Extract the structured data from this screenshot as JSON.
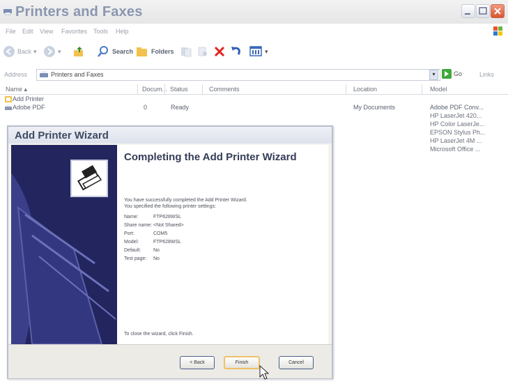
{
  "window": {
    "title": "Printers and Faxes"
  },
  "menu": [
    "File",
    "Edit",
    "View",
    "Favorites",
    "Tools",
    "Help"
  ],
  "toolbar": {
    "back": "Back",
    "search": "Search",
    "folders": "Folders"
  },
  "address": {
    "label": "Address",
    "value": "Printers and Faxes",
    "go": "Go",
    "links": "Links"
  },
  "columns": {
    "name": "Name",
    "documents": "Docum...",
    "status": "Status",
    "comments": "Comments",
    "location": "Location",
    "model": "Model"
  },
  "rows": [
    {
      "name": "Add Printer"
    },
    {
      "name": "Adobe PDF",
      "documents": "0",
      "status": "Ready",
      "location": "My Documents",
      "model": "Adobe PDF Conv..."
    }
  ],
  "other_models": [
    "HP LaserJet 420...",
    "HP Color LaserJe...",
    "EPSON Stylus Ph...",
    "HP LaserJet 4M ...",
    "Microsoft Office ..."
  ],
  "wizard": {
    "title": "Add Printer Wizard",
    "heading": "Completing the Add Printer Wizard",
    "line1": "You have successfully completed the Add Printer Wizard.",
    "line2": "You specified the following printer settings:",
    "settings": [
      {
        "key": "Name:",
        "value": "FTP628WSL"
      },
      {
        "key": "Share name:",
        "value": "<Not Shared>"
      },
      {
        "key": "Port:",
        "value": "COM5"
      },
      {
        "key": "Model:",
        "value": "FTP628WSL"
      },
      {
        "key": "Default:",
        "value": "No"
      },
      {
        "key": "Test page:",
        "value": "No"
      }
    ],
    "close_hint": "To close the wizard, click Finish.",
    "back": "< Back",
    "finish": "Finish",
    "cancel": "Cancel"
  }
}
